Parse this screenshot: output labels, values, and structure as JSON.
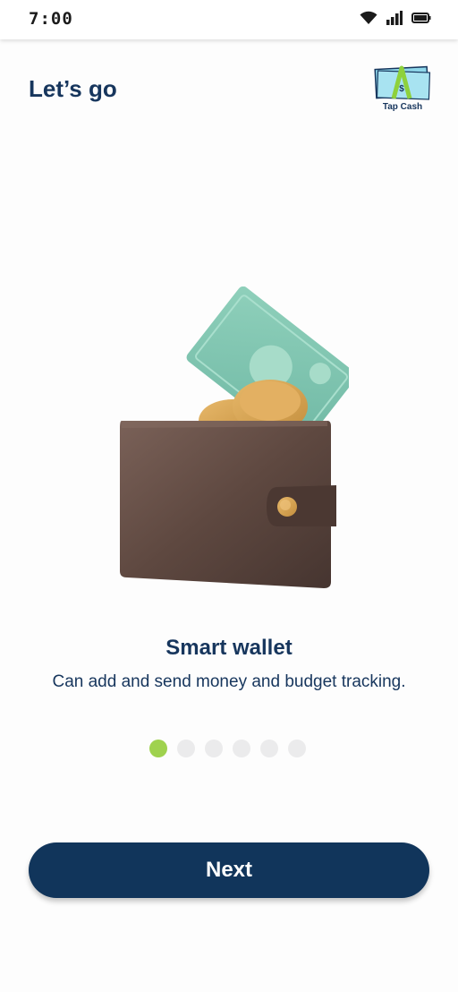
{
  "status_bar": {
    "time": "7:00",
    "icons": [
      "wifi-icon",
      "signal-icon",
      "battery-icon"
    ]
  },
  "header": {
    "title": "Let’s go",
    "logo_text": "Tap Cash"
  },
  "slide": {
    "illustration": "wallet-with-money",
    "title": "Smart wallet",
    "subtitle": "Can add and send money and budget tracking."
  },
  "pager": {
    "total": 6,
    "active_index": 0,
    "active_color": "#9fd24e",
    "inactive_color": "#ebebec"
  },
  "actions": {
    "next_label": "Next",
    "button_color": "#11355b"
  },
  "colors": {
    "text_primary": "#17365d",
    "background": "#fdfdfd"
  }
}
